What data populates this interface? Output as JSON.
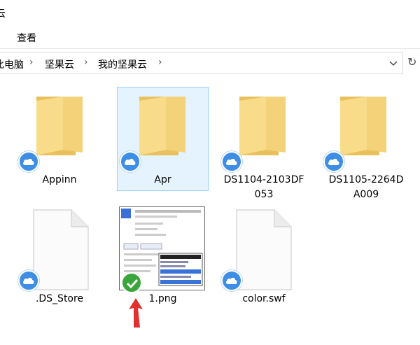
{
  "window": {
    "title_fragment": "云"
  },
  "ribbon": {
    "tab_view": "查看"
  },
  "address": {
    "crumbs": [
      "此电脑",
      "坚果云",
      "我的坚果云"
    ]
  },
  "items": [
    {
      "label": "Appinn",
      "type": "folder",
      "status": "cloud"
    },
    {
      "label": "Apr",
      "type": "folder",
      "status": "cloud",
      "selected": true
    },
    {
      "label_line1": "DS1104-2103DF",
      "label_line2": "053",
      "type": "folder",
      "status": "cloud"
    },
    {
      "label_line1": "DS1105-2264D",
      "label_line2": "A009",
      "type": "folder",
      "status": "cloud"
    },
    {
      "label": ".DS_Store",
      "type": "file",
      "status": "cloud"
    },
    {
      "label": "1.png",
      "type": "image",
      "status": "synced"
    },
    {
      "label": "color.swf",
      "type": "file",
      "status": "cloud"
    }
  ],
  "colors": {
    "folder": "#f8dc8a",
    "folder_dark": "#e9c15c",
    "cloud_badge": "#3f8ee5",
    "sync_badge": "#3aa53a",
    "selection": "#e5f3ff",
    "arrow": "#e03030"
  },
  "icons": {
    "cloud_badge": "cloud-icon",
    "synced_badge": "check-icon",
    "annotation": "red-arrow-icon"
  }
}
